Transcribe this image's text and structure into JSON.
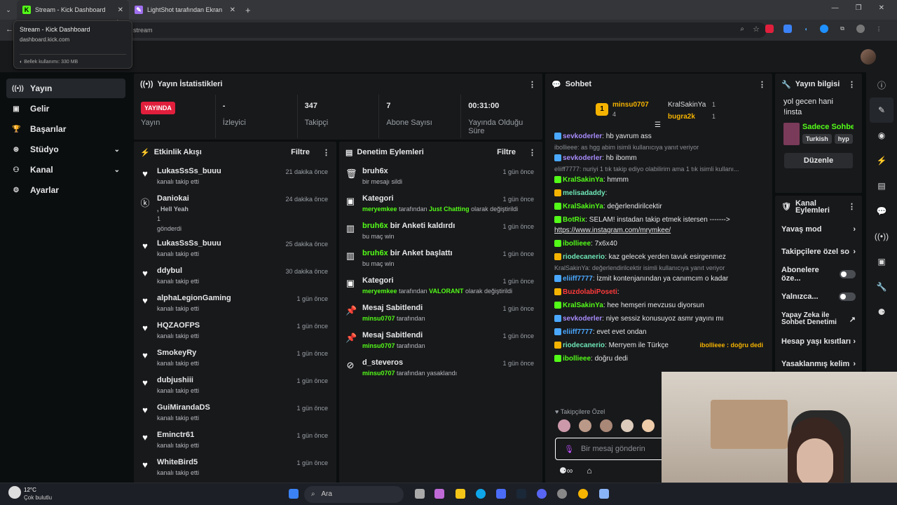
{
  "browser": {
    "tabs": [
      {
        "title": "Stream - Kick Dashboard",
        "favicon": "K",
        "active": true
      },
      {
        "title": "LightShot tarafından Ekran Gör..."
      }
    ],
    "new_tab": "+",
    "address_text": "stream",
    "tooltip": {
      "title": "Stream - Kick Dashboard",
      "url": "dashboard.kick.com",
      "memory": "Bellek kullanımı: 330 MB"
    }
  },
  "sidebar": {
    "items": [
      {
        "label": "Yayın",
        "icon": "stream-icon",
        "active": true
      },
      {
        "label": "Gelir",
        "icon": "revenue-icon"
      },
      {
        "label": "Başarılar",
        "icon": "trophy-icon"
      },
      {
        "label": "Stüdyo",
        "icon": "studio-icon",
        "expand": true
      },
      {
        "label": "Kanal",
        "icon": "channel-icon",
        "expand": true
      },
      {
        "label": "Ayarlar",
        "icon": "gear-icon"
      }
    ]
  },
  "stats": {
    "title": "Yayın İstatistikleri",
    "items": [
      {
        "value": "YAYINDA",
        "label": "Yayın"
      },
      {
        "value": "-",
        "label": "İzleyici"
      },
      {
        "value": "347",
        "label": "Takipçi"
      },
      {
        "value": "7",
        "label": "Abone Sayısı"
      },
      {
        "value": "00:31:00",
        "label": "Yayında Olduğu Süre"
      }
    ]
  },
  "activity": {
    "title": "Etkinlik Akışı",
    "filter": "Filtre",
    "events": [
      {
        "name": "LukasSsSs_buuu",
        "sub": "kanalı takip etti",
        "time": "21 dakika önce"
      },
      {
        "name": "Daniokai",
        "sub": ", Hell Yeah",
        "extra": "1",
        "sub2": "gönderdi",
        "time": "24 dakika önce"
      },
      {
        "name": "LukasSsSs_buuu",
        "sub": "kanalı takip etti",
        "time": "25 dakika önce"
      },
      {
        "name": "ddybul",
        "sub": "kanalı takip etti",
        "time": "30 dakika önce"
      },
      {
        "name": "alphaLegionGaming",
        "sub": "kanalı takip etti",
        "time": "1 gün önce"
      },
      {
        "name": "HQZAOFPS",
        "sub": "kanalı takip etti",
        "time": "1 gün önce"
      },
      {
        "name": "SmokeyRy",
        "sub": "kanalı takip etti",
        "time": "1 gün önce"
      },
      {
        "name": "dubjushiii",
        "sub": "kanalı takip etti",
        "time": "1 gün önce"
      },
      {
        "name": "GuiMirandaDS",
        "sub": "kanalı takip etti",
        "time": "1 gün önce"
      },
      {
        "name": "Eminctr61",
        "sub": "kanalı takip etti",
        "time": "1 gün önce"
      },
      {
        "name": "WhiteBird5",
        "sub": "kanalı takip etti",
        "time": "1 gün önce"
      }
    ]
  },
  "moderation": {
    "title": "Denetim Eylemleri",
    "filter": "Filtre",
    "events": [
      {
        "name": "bruh6x",
        "sub": "bir mesajı sildi",
        "time": "1 gün önce",
        "icon": "trash-icon"
      },
      {
        "name": "Kategori",
        "user": "meryemkee",
        "sub": "tarafından",
        "cat": "Just Chatting",
        "sub2": "olarak değiştirildi",
        "time": "1 gün önce",
        "icon": "category-icon"
      },
      {
        "name_green": "bruh6x",
        "name": "bir Anketi kaldırdı",
        "sub": "bu maç win",
        "time": "1 gün önce",
        "icon": "poll-icon"
      },
      {
        "name_green": "bruh6x",
        "name": "bir Anket başlattı",
        "sub": "bu maç win",
        "time": "1 gün önce",
        "icon": "poll-icon"
      },
      {
        "name": "Kategori",
        "user": "meryemkee",
        "sub": "tarafından",
        "cat": "VALORANT",
        "sub2": "olarak değiştirildi",
        "time": "1 gün önce",
        "icon": "category-icon"
      },
      {
        "name": "Mesaj Sabitlendi",
        "user": "minsu0707",
        "sub": "tarafından",
        "time": "1 gün önce",
        "icon": "pin-icon"
      },
      {
        "name": "Mesaj Sabitlendi",
        "user": "minsu0707",
        "sub": "tarafından",
        "time": "1 gün önce",
        "icon": "pin-icon"
      },
      {
        "name": "d_steveros",
        "user": "minsu0707",
        "sub": "tarafından yasaklandı",
        "time": "1 gün önce",
        "icon": "ban-icon"
      }
    ]
  },
  "chat": {
    "title": "Sohbet",
    "top": [
      {
        "name": "minsu0707",
        "count": "4"
      },
      {
        "name": "KralSakinYa",
        "count": "1"
      },
      {
        "name": "bugra2k",
        "count": "1"
      }
    ],
    "messages": [
      {
        "user": "sevkoderler",
        "text": ": hb yavrum ass",
        "cls": "u2"
      },
      {
        "reply": "ibollieee: as hgg abim isimli kullanıcıya yanıt veriyor"
      },
      {
        "user": "sevkoderler",
        "text": ": hb ibomm",
        "cls": "u2"
      },
      {
        "reply": "eliiff7777: nuriyi 1 tık takip ediyo olabilirim ama 1 tık isimli kullanı..."
      },
      {
        "user": "KralSakinYa",
        "text": ": hmmm",
        "cls": "u1"
      },
      {
        "user": "melisadaddy",
        "text": ":",
        "cls": "u5"
      },
      {
        "user": "KralSakinYa",
        "text": ": değerlendirilcektir",
        "cls": "u1"
      },
      {
        "user": "BotRix",
        "text": ": SELAM! instadan takip etmek istersen -------> ",
        "link": "https://www.instagram.com/mrymkee/",
        "cls": "u1"
      },
      {
        "user": "ibollieee",
        "text": ": 7x6x40",
        "cls": "u1"
      },
      {
        "user": "riodecanerio",
        "text": ": kaz gelecek yerden tavuk esirgenmez",
        "cls": "u5"
      },
      {
        "reply": "KralSakinYa: değerlendirilcektir isimli kullanıcıya yanıt veriyor"
      },
      {
        "user": "eliiff7777",
        "text": ": İzmit kontenjanından ya canımcım o kadar",
        "cls": "u3"
      },
      {
        "user": "BuzdolabiPoseti",
        "text": ":",
        "cls": "u4"
      },
      {
        "user": "KralSakinYa",
        "text": ": hee hemşeri mevzusu diyorsun",
        "cls": "u1"
      },
      {
        "user": "sevkoderler",
        "text": ": niye sessiz konusuyoz asmr yayını mı",
        "cls": "u2"
      },
      {
        "user": "eliiff7777",
        "text": ": evet evet ondan",
        "cls": "u3"
      },
      {
        "user": "riodecanerio",
        "text": ": Merryem ile Türkçe",
        "cls": "u5",
        "pinned": "ibollieee : doğru dedi"
      },
      {
        "user": "ibollieee",
        "text": ": doğru dedi",
        "cls": "u1"
      }
    ],
    "followers_only": "Takipçilere Özel",
    "input_placeholder": "Bir mesaj gönderin"
  },
  "stream_info": {
    "title": "Yayın bilgisi",
    "stream_title": "yol gecen hani !insta",
    "category": "Sadece Sohbe",
    "tags": [
      "Turkish",
      "hyp"
    ],
    "edit": "Düzenle"
  },
  "channel_actions": {
    "title": "Kanal Eylemleri",
    "items": [
      {
        "label": "Yavaş mod",
        "type": "arrow"
      },
      {
        "label": "Takipçilere özel so",
        "type": "arrow"
      },
      {
        "label": "Abonelere öze...",
        "type": "toggle"
      },
      {
        "label": "Yalnızca...",
        "type": "toggle"
      },
      {
        "label": "Yapay Zeka ile Sohbet Denetimi",
        "type": "external"
      },
      {
        "label": "Hesap yaşı kısıtları",
        "type": "arrow"
      },
      {
        "label": "Yasaklanmış kelim",
        "type": "arrow"
      }
    ]
  },
  "taskbar": {
    "weather_temp": "12°C",
    "weather_desc": "Çok bulutlu",
    "search": "Ara"
  }
}
